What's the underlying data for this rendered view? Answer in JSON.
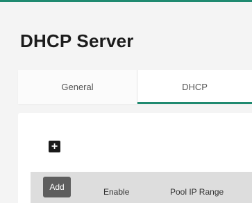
{
  "page": {
    "title": "DHCP Server"
  },
  "tabs": [
    {
      "label": "General",
      "active": false
    },
    {
      "label": "DHCP",
      "active": true
    }
  ],
  "toolbar": {
    "add_icon": "plus-square-icon",
    "add_icon_glyph": "+"
  },
  "table": {
    "add_button_label": "Add",
    "columns": [
      "Enable",
      "Pool IP Range"
    ]
  },
  "colors": {
    "accent": "#1f8a70",
    "header_background": "#dddddd",
    "add_button": "#5e5e5e"
  }
}
